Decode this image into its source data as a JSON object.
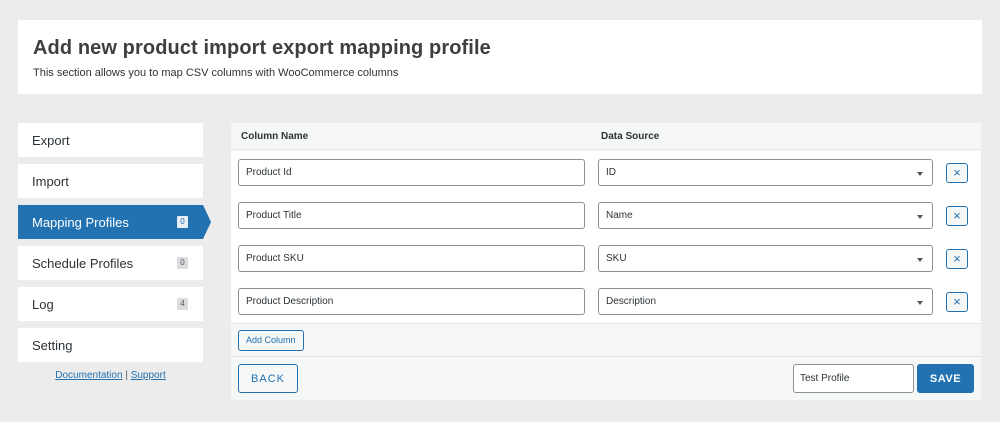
{
  "header": {
    "title": "Add new product import export mapping profile",
    "subtitle": "This section allows you to map CSV columns with WooCommerce columns"
  },
  "sidebar": {
    "items": [
      {
        "label": "Export",
        "badge": ""
      },
      {
        "label": "Import",
        "badge": ""
      },
      {
        "label": "Mapping Profiles",
        "badge": "0",
        "active": true
      },
      {
        "label": "Schedule Profiles",
        "badge": "0"
      },
      {
        "label": "Log",
        "badge": "4"
      },
      {
        "label": "Setting",
        "badge": ""
      }
    ],
    "links": {
      "documentation": "Documentation",
      "separator": "|",
      "support": "Support"
    }
  },
  "table": {
    "headers": {
      "column_name": "Column Name",
      "data_source": "Data Source"
    },
    "rows": [
      {
        "column_name": "Product Id",
        "data_source": "ID"
      },
      {
        "column_name": "Product Title",
        "data_source": "Name"
      },
      {
        "column_name": "Product SKU",
        "data_source": "SKU"
      },
      {
        "column_name": "Product Description",
        "data_source": "Description"
      }
    ],
    "remove_symbol": "×",
    "add_column_label": "Add Column"
  },
  "footer": {
    "back_label": "BACK",
    "profile_name": "Test Profile",
    "save_label": "SAVE"
  },
  "colors": {
    "accent": "#2271b1",
    "background": "#ececec"
  }
}
